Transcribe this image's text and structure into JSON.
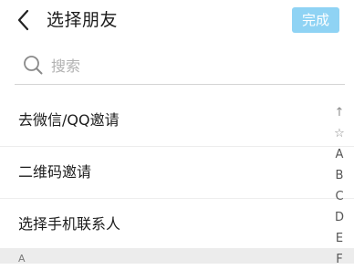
{
  "header": {
    "title": "选择朋友",
    "done_label": "完成"
  },
  "search": {
    "placeholder": "搜索",
    "value": ""
  },
  "options": [
    {
      "label": "去微信/QQ邀请"
    },
    {
      "label": "二维码邀请"
    },
    {
      "label": "选择手机联系人"
    }
  ],
  "section": {
    "label": "A"
  },
  "index_bar": {
    "items": [
      {
        "icon": "arrow-up-icon",
        "glyph": "↑"
      },
      {
        "icon": "star-icon",
        "glyph": "☆"
      },
      {
        "label": "A"
      },
      {
        "label": "B"
      },
      {
        "label": "C"
      },
      {
        "label": "D"
      },
      {
        "label": "E"
      },
      {
        "label": "F"
      }
    ]
  },
  "colors": {
    "done_button_bg": "#8fd3f4",
    "done_button_text": "#ffffff",
    "section_bg": "#ececec",
    "divider": "#ededed"
  }
}
